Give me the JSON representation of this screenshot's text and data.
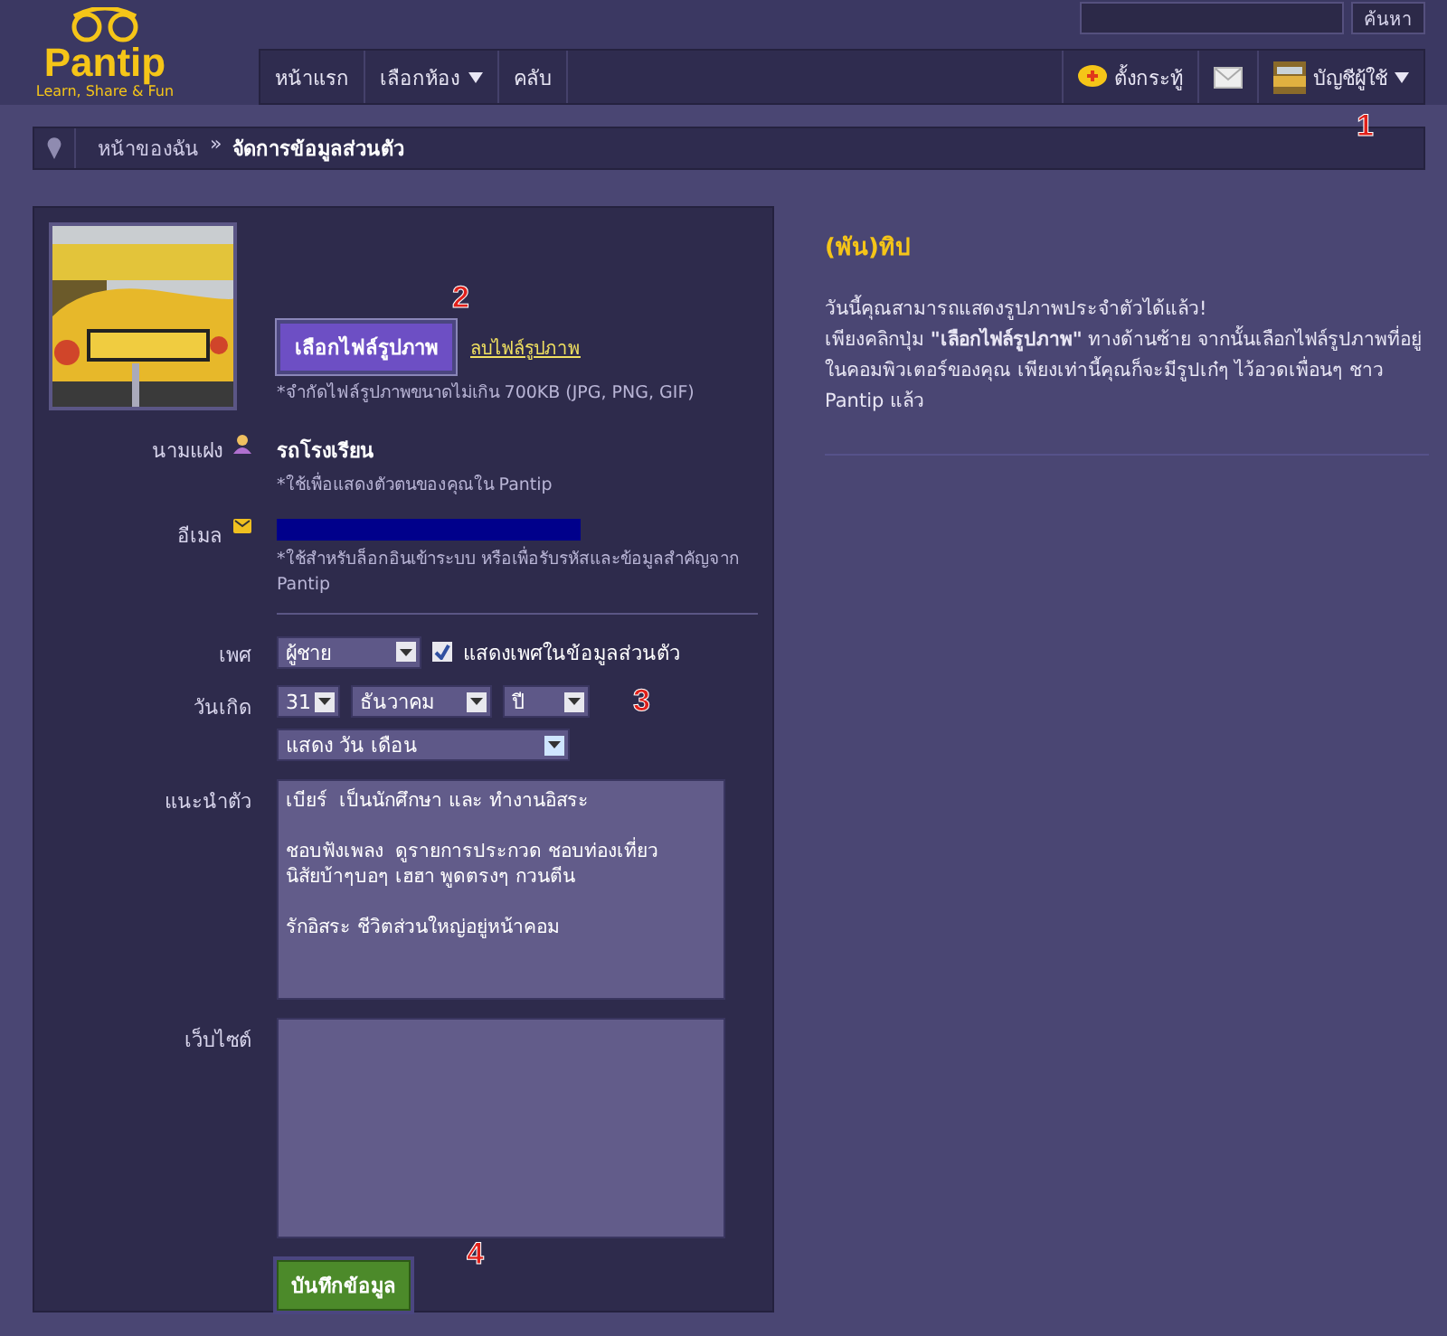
{
  "header": {
    "logo": {
      "name": "Pantip",
      "tagline": "Learn, Share & Fun"
    },
    "search": {
      "button": "ค้นหา"
    },
    "nav": [
      {
        "label": "หน้าแรก",
        "dropdown": false
      },
      {
        "label": "เลือกห้อง",
        "dropdown": true
      },
      {
        "label": "คลับ",
        "dropdown": false
      }
    ],
    "actions": {
      "new_topic": "ตั้งกระทู้",
      "account": "บัญชีผู้ใช้"
    }
  },
  "breadcrumb": {
    "home": "หน้าของฉัน",
    "separator": "»",
    "current": "จัดการข้อมูลส่วนตัว"
  },
  "profile_form": {
    "upload": {
      "choose_button": "เลือกไฟล์รูปภาพ",
      "delete_link": "ลบไฟล์รูปภาพ",
      "hint": "*จำกัดไฟล์รูปภาพขนาดไม่เกิน 700KB (JPG, PNG, GIF)"
    },
    "display_name": {
      "label": "นามแฝง",
      "value": "รถโรงเรียน",
      "hint": "*ใช้เพื่อแสดงตัวตนของคุณใน Pantip"
    },
    "email": {
      "label": "อีเมล",
      "redacted": true,
      "hint": "*ใช้สำหรับล็อกอินเข้าระบบ หรือเพื่อรับรหัสและข้อมูลสำคัญจาก Pantip"
    },
    "gender": {
      "label": "เพศ",
      "value": "ผู้ชาย",
      "show_checkbox": {
        "label": "แสดงเพศในข้อมูลส่วนตัว",
        "checked": true
      }
    },
    "birthday": {
      "label": "วันเกิด",
      "day": "31",
      "month": "ธันวาคม",
      "year": "ปี",
      "display": "แสดง วัน เดือน"
    },
    "bio": {
      "label": "แนะนำตัว",
      "value": "เบียร์  เป็นนักศึกษา และ ทำงานอิสระ\n\nชอบฟังเพลง  ดูรายการประกวด ชอบท่องเที่ยว\nนิสัยบ้าๆบอๆ เฮฮา พูดตรงๆ กวนตีน\n\nรักอิสระ ชีวิตส่วนใหญ่อยู่หน้าคอม"
    },
    "website": {
      "label": "เว็บไซต์"
    },
    "save_button": "บันทึกข้อมูล"
  },
  "tip": {
    "title": "(พัน)ทิป",
    "lines": [
      "วันนี้คุณสามารถแสดงรูปภาพประจำตัวได้แล้ว!",
      "เพียงคลิกปุ่ม **\"เลือกไฟล์รูปภาพ\"** ทางด้านซ้าย จากนั้นเลือกไฟล์รูปภาพที่อยู่ในคอมพิวเตอร์ของคุณ เพียงเท่านี้คุณก็จะมีรูปเก๋ๆ ไว้อวดเพื่อนๆ ชาว Pantip แล้ว"
    ]
  },
  "annotations": [
    {
      "label": "1"
    },
    {
      "label": "2"
    },
    {
      "label": "3"
    },
    {
      "label": "4"
    }
  ]
}
